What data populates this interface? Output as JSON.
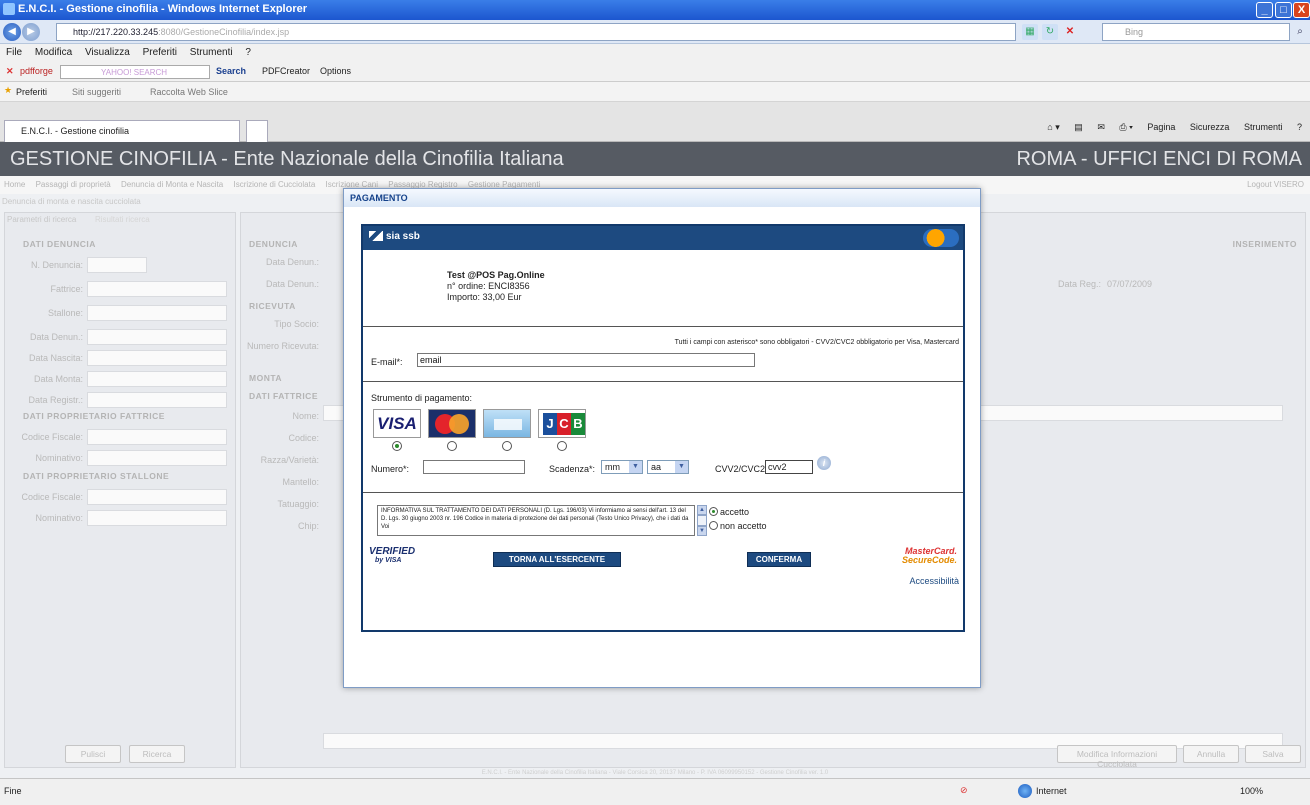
{
  "window": {
    "title": "E.N.C.I. - Gestione cinofilia - Windows Internet Explorer",
    "btn_min": "_",
    "btn_max": "□",
    "btn_close": "X"
  },
  "browser": {
    "url_host": "http://217.220.33.245",
    "url_path": ":8080/GestioneCinofilia/index.jsp",
    "search_placeholder": "Bing",
    "menu": [
      "File",
      "Modifica",
      "Visualizza",
      "Preferiti",
      "Strumenti",
      "?"
    ],
    "toolbar": {
      "brand": "pdfforge",
      "yahoo": "YAHOO! SEARCH",
      "search_btn": "Search",
      "pdfcreator": "PDFCreator",
      "options": "Options"
    },
    "favorites": {
      "label": "Preferiti",
      "suggested": "Siti suggeriti",
      "webslice": "Raccolta Web Slice"
    },
    "tab": "E.N.C.I. - Gestione cinofilia",
    "commands": [
      "Pagina",
      "Sicurezza",
      "Strumenti"
    ]
  },
  "app": {
    "title": "GESTIONE CINOFILIA - Ente Nazionale della Cinofilia Italiana",
    "office": "ROMA - UFFICI ENCI DI ROMA",
    "menu": [
      "Home",
      "Passaggi di proprietà",
      "Denuncia di Monta e Nascita",
      "Iscrizione di Cucciolata",
      "Iscrizione Cani",
      "Passaggio Registro",
      "Gestione Pagamenti"
    ],
    "logout": "Logout VISERO",
    "breadcrumb": "Denuncia di monta e nascita cucciolata",
    "tabs": [
      "Parametri di ricerca",
      "Risultati ricerca"
    ],
    "left_sections": [
      "DATI DENUNCIA",
      "DATI PROPRIETARIO FATTRICE",
      "DATI PROPRIETARIO STALLONE"
    ],
    "left_labels": [
      "N. Denuncia:",
      "Fattrice:",
      "Stallone:",
      "Data Denun.:",
      "Data Nascita:",
      "Data Monta:",
      "Data Registr.:"
    ],
    "left_labels2": [
      "Codice Fiscale:",
      "Nominativo:"
    ],
    "left_labels3": [
      "Codice Fiscale:",
      "Nominativo:"
    ],
    "left_buttons": [
      "Pulisci",
      "Ricerca"
    ],
    "main_section": "DENUNCIA",
    "inserimento": "INSERIMENTO",
    "main_labels": [
      {
        "s": "",
        "t": "N. Denuncia:"
      },
      {
        "s": "",
        "t": "Data Denun.:"
      },
      {
        "s": "RICEVUTA",
        "t": ""
      },
      {
        "s": "",
        "t": "Tipo Socio:"
      },
      {
        "s": "",
        "t": "Numero Ricevuta:"
      },
      {
        "s": "MONTA",
        "t": ""
      },
      {
        "s": "DATI FATTRICE",
        "t": ""
      },
      {
        "s": "",
        "t": "Nome:"
      },
      {
        "s": "",
        "t": "Codice:"
      },
      {
        "s": "",
        "t": "Razza/Varietà:"
      },
      {
        "s": "",
        "t": "Mantello:"
      },
      {
        "s": "",
        "t": "Tatuaggio:"
      },
      {
        "s": "",
        "t": "Chip:"
      }
    ],
    "data_reg_label": "Data Reg.:",
    "data_reg": "07/07/2009",
    "bottom_buttons": [
      "Modifica Informazioni Cucciolata",
      "Annulla",
      "Salva"
    ],
    "footer": "E.N.C.I. - Ente Nazionale della Cinofilia Italiana - Viale Corsica 20, 20137 Milano - P. IVA 06099950152 - Gestione Cinofilia ver. 1.0"
  },
  "modal": {
    "title": "PAGAMENTO",
    "provider": "sia ssb",
    "merchant": "Test @POS Pag.Online",
    "order": "n° ordine: ENCI8356",
    "amount": "Importo: 33,00 Eur",
    "legal": "Tutti i campi con asterisco* sono obbligatori - CVV2/CVC2 obbligatorio per Visa, Mastercard",
    "email_label": "E-mail*:",
    "email_value": "email",
    "instrument_label": "Strumento di pagamento:",
    "cards": [
      "VISA",
      "MasterCard",
      "American Express",
      "JCB"
    ],
    "selected_card": "VISA",
    "number_label": "Numero*:",
    "expiry_label": "Scadenza*:",
    "expiry_month": "mm",
    "expiry_year": "aa",
    "cvv_label": "CVV2/CVC2:",
    "cvv_value": "cvv2",
    "privacy_text": "INFORMATIVA SUL TRATTAMENTO DEI DATI PERSONALI (D. Lgs. 196/03) Vi informiamo ai sensi dell'art. 13 del D. Lgs. 30 giugno 2003 nr. 196 Codice in materia di protezione dei dati personali (Testo Unico Privacy), che i dati da Voi",
    "accept": "accetto",
    "decline": "non accetto",
    "verified": "VERIFIED",
    "by_visa": "by VISA",
    "back_btn": "TORNA ALL'ESERCENTE",
    "confirm_btn": "CONFERMA",
    "mc_line1": "MasterCard.",
    "mc_line2": "SecureCode.",
    "access": "Accessibilità"
  },
  "status": {
    "left": "Fine",
    "zone": "Internet",
    "zoom": "100%"
  }
}
